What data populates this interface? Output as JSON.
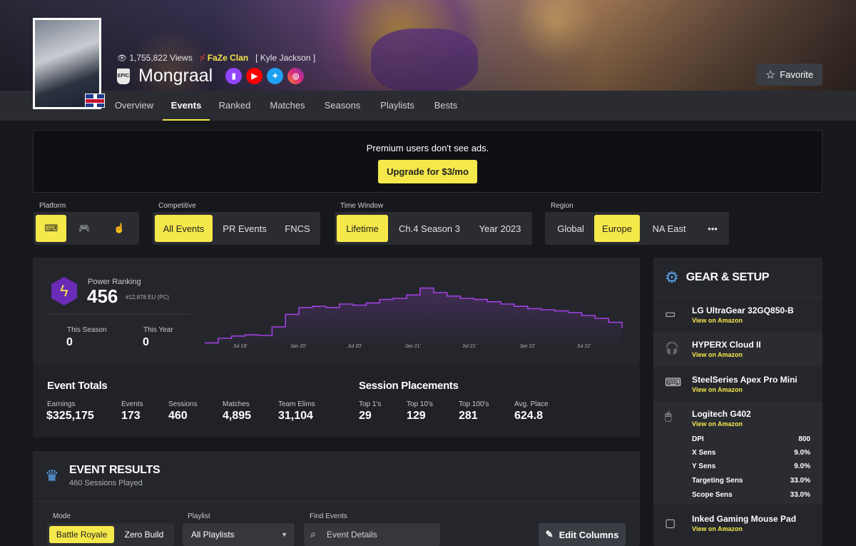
{
  "profile": {
    "views": "1,755,822 Views",
    "clan": "FaZe Clan",
    "real_name": "[ Kyle Jackson ]",
    "name": "Mongraal",
    "epic_badge": "EPIC",
    "favorite_label": "Favorite",
    "flag": "uk-flag"
  },
  "tabs": [
    {
      "label": "Overview"
    },
    {
      "label": "Events"
    },
    {
      "label": "Ranked"
    },
    {
      "label": "Matches"
    },
    {
      "label": "Seasons"
    },
    {
      "label": "Playlists"
    },
    {
      "label": "Bests"
    }
  ],
  "active_tab": "Events",
  "ad": {
    "message": "Premium users don't see ads.",
    "button": "Upgrade for $3/mo"
  },
  "filters": {
    "platform": {
      "label": "Platform",
      "options": [
        "keyboard-icon",
        "gamepad-icon",
        "touch-icon"
      ],
      "selected": "keyboard-icon"
    },
    "competitive": {
      "label": "Competitive",
      "options": [
        "All Events",
        "PR Events",
        "FNCS"
      ],
      "selected": "All Events"
    },
    "time_window": {
      "label": "Time Window",
      "options": [
        "Lifetime",
        "Ch.4 Season 3",
        "Year 2023"
      ],
      "selected": "Lifetime"
    },
    "region": {
      "label": "Region",
      "options": [
        "Global",
        "Europe",
        "NA East",
        "•••"
      ],
      "selected": "Europe"
    }
  },
  "power_ranking": {
    "label": "Power Ranking",
    "value": "456",
    "sub": "#12,878 EU (PC)",
    "this_season_label": "This Season",
    "this_season": "0",
    "this_year_label": "This Year",
    "this_year": "0"
  },
  "chart_data": {
    "type": "area",
    "x_ticks": [
      "Jul 19'",
      "Jan 20'",
      "Jul 20'",
      "Jan 21'",
      "Jul 21'",
      "Jan 22'",
      "Jul 22'"
    ],
    "values": [
      2,
      10,
      14,
      16,
      15,
      30,
      52,
      64,
      66,
      64,
      70,
      68,
      72,
      78,
      80,
      86,
      98,
      90,
      84,
      80,
      78,
      74,
      70,
      66,
      62,
      60,
      58,
      55,
      50,
      45,
      38,
      28
    ],
    "ylim": [
      0,
      110
    ],
    "color": "#a040e0"
  },
  "event_totals": {
    "title": "Event Totals",
    "stats": [
      {
        "label": "Earnings",
        "value": "$325,175"
      },
      {
        "label": "Events",
        "value": "173"
      },
      {
        "label": "Sessions",
        "value": "460"
      },
      {
        "label": "Matches",
        "value": "4,895"
      },
      {
        "label": "Team Elims",
        "value": "31,104"
      }
    ]
  },
  "session_placements": {
    "title": "Session Placements",
    "stats": [
      {
        "label": "Top 1's",
        "value": "29"
      },
      {
        "label": "Top 10's",
        "value": "129"
      },
      {
        "label": "Top 100's",
        "value": "281"
      },
      {
        "label": "Avg. Place",
        "value": "624.8"
      }
    ]
  },
  "gear": {
    "title": "GEAR & SETUP",
    "link_label": "View on Amazon",
    "items": [
      {
        "name": "LG UltraGear 32GQ850-B",
        "icon": "monitor-icon"
      },
      {
        "name": "HYPERX Cloud II",
        "icon": "headset-icon"
      },
      {
        "name": "SteelSeries Apex Pro Mini",
        "icon": "keyboard-icon"
      },
      {
        "name": "Logitech G402",
        "icon": "mouse-icon"
      },
      {
        "name": "Inked Gaming Mouse Pad",
        "icon": "mousepad-icon"
      }
    ],
    "sensitivity": [
      {
        "label": "DPI",
        "value": "800"
      },
      {
        "label": "X Sens",
        "value": "9.0%"
      },
      {
        "label": "Y Sens",
        "value": "9.0%"
      },
      {
        "label": "Targeting Sens",
        "value": "33.0%"
      },
      {
        "label": "Scope Sens",
        "value": "33.0%"
      }
    ]
  },
  "event_results": {
    "title": "EVENT RESULTS",
    "subtitle": "460 Sessions Played",
    "mode_label": "Mode",
    "modes": [
      "Battle Royale",
      "Zero Build"
    ],
    "mode_selected": "Battle Royale",
    "playlist_label": "Playlist",
    "playlist_value": "All Playlists",
    "find_label": "Find Events",
    "find_placeholder": "Event Details",
    "edit_columns": "Edit Columns"
  },
  "colors": {
    "accent": "#f5e84a",
    "panel": "#24262c",
    "background": "#16181c",
    "chart_line": "#a040e0"
  }
}
